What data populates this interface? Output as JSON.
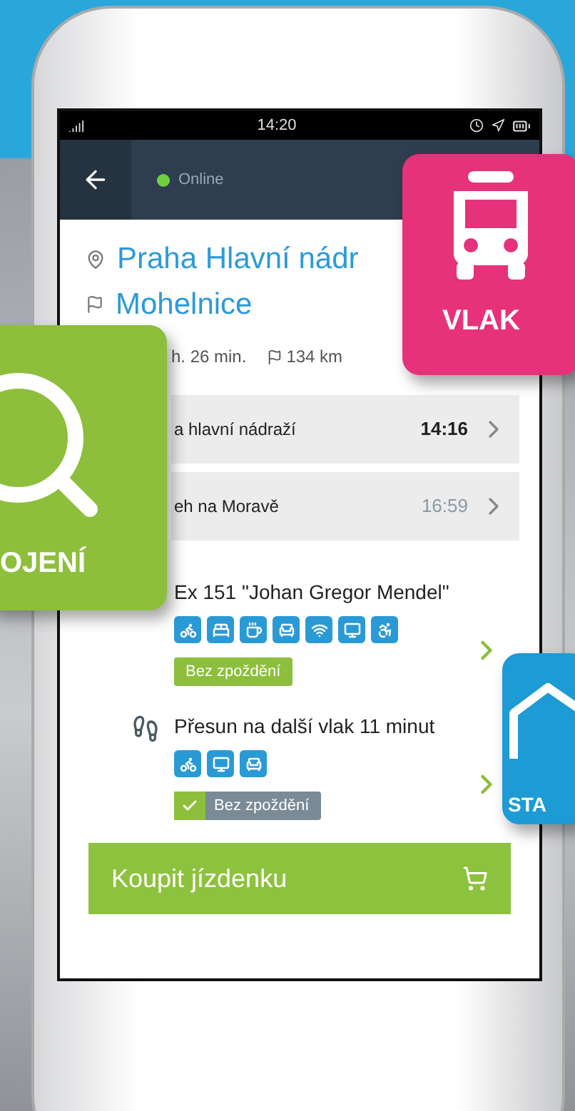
{
  "status_bar": {
    "time": "14:20"
  },
  "header": {
    "status": "Online",
    "online": true
  },
  "route": {
    "from": "Praha Hlavní nádr",
    "to": "Mohelnice"
  },
  "summary": {
    "duration": "h. 26 min.",
    "distance": "134 km"
  },
  "stops": [
    {
      "name": "a hlavní nádraží",
      "time": "14:16",
      "emphasized": true
    },
    {
      "name": "eh na Moravě",
      "time": "16:59",
      "emphasized": false
    }
  ],
  "legs": [
    {
      "kind": "train",
      "title": "Ex 151 \"Johan Gregor Mendel\"",
      "status": "Bez zpoždění",
      "checked": false
    },
    {
      "kind": "walk",
      "title": "Přesun na další vlak 11 minut",
      "status": "Bez zpoždění",
      "checked": true
    }
  ],
  "buy_button": {
    "label": "Koupit jízdenku"
  },
  "tiles": [
    {
      "kind": "train",
      "label": "VLAK",
      "color": "#e6317b"
    },
    {
      "kind": "search",
      "label": "OJENÍ",
      "color": "#8dbf3c"
    },
    {
      "kind": "station",
      "label": "STA",
      "color": "#1c9bd4"
    }
  ]
}
